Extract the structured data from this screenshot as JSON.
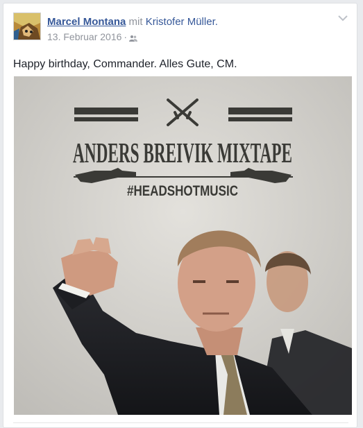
{
  "post": {
    "author": "Marcel Montana",
    "with_word": "mit",
    "tagged": "Kristofer Müller.",
    "date": "13. Februar 2016",
    "separator": "·",
    "audience_icon": "friends-icon",
    "menu_icon": "chevron-down-icon",
    "text": "Happy birthday, Commander. Alles Gute, CM."
  },
  "photo": {
    "title": "ANDERS BREIVIK MIXTAPE",
    "hashtag": "#HEADSHOTMUSIC",
    "icons": [
      "crossed-rifles-icon",
      "rifle-icon"
    ]
  },
  "colors": {
    "link": "#365899",
    "meta": "#90949c",
    "text": "#1d2129",
    "photo_ink": "#3a3a36",
    "photo_bg": "#d2d0cb"
  }
}
